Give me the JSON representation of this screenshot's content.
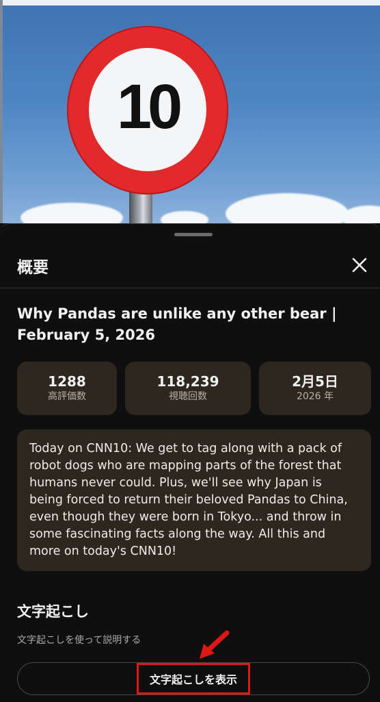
{
  "video": {
    "sign_text": "10"
  },
  "sheet": {
    "title": "概要",
    "video_title": "Why Pandas are unlike any other bear | February 5, 2026",
    "stats": [
      {
        "value": "1288",
        "label": "高評価数"
      },
      {
        "value": "118,239",
        "label": "視聴回数"
      },
      {
        "value": "2月5日",
        "label": "2026 年"
      }
    ],
    "description": "Today on CNN10: We get to tag along with a pack of robot dogs who are mapping parts of the forest that humans never could. Plus, we'll see why Japan is being forced to return their beloved Pandas to China, even though they were born in Tokyo... and throw in some fascinating facts along the way. All this and more on today's CNN10!",
    "transcript": {
      "heading": "文字起こし",
      "subtitle": "文字起こしを使って説明する",
      "button_label": "文字起こしを表示"
    }
  },
  "colors": {
    "highlight": "#e01717",
    "card_bg": "#2e271f",
    "sheet_bg": "#0f0f0f"
  }
}
